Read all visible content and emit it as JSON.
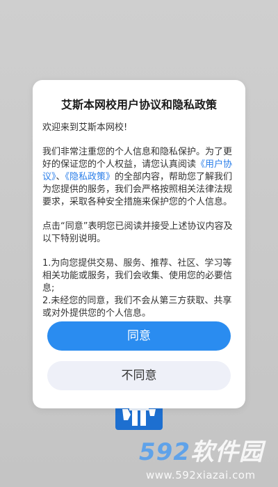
{
  "dialog": {
    "title": "艾斯本网校用户协议和隐私政策",
    "welcome": "欢迎来到艾斯本网校!",
    "para1_a": "我们非常注重您的个人信息和隐私保护。为了更好的保证您的个人权益，请您认真阅读",
    "link_user_agreement": "《用户协议》",
    "para1_sep": "、",
    "link_privacy_policy": "《隐私政策》",
    "para1_b": "的全部内容，帮助您了解我们为您提供的服务，我们会严格按照相关法律法规要求，采取各种安全措施来保护您的个人信息。",
    "para2": "点击“同意”表明您已阅读并接受上述协议内容及以下特别说明。",
    "item1": "1.为向您提供交易、服务、推荐、社区、学习等相关功能或服务，我们会收集、使用您的必要信息;",
    "item2": "2.未经您的同意，我们不会从第三方获取、共享或对外提供您的个人信息。",
    "agree_label": "同意",
    "disagree_label": "不同意"
  },
  "watermark": {
    "logo_num": "592",
    "logo_text": "软件园",
    "url": "www.592xiazai.com"
  },
  "colors": {
    "accent": "#2a8cf0",
    "link": "#2a7ee9",
    "secondary_button": "#eef0f8",
    "overlay": "#c8c8c8",
    "app_icon": "#1d6fd0"
  }
}
